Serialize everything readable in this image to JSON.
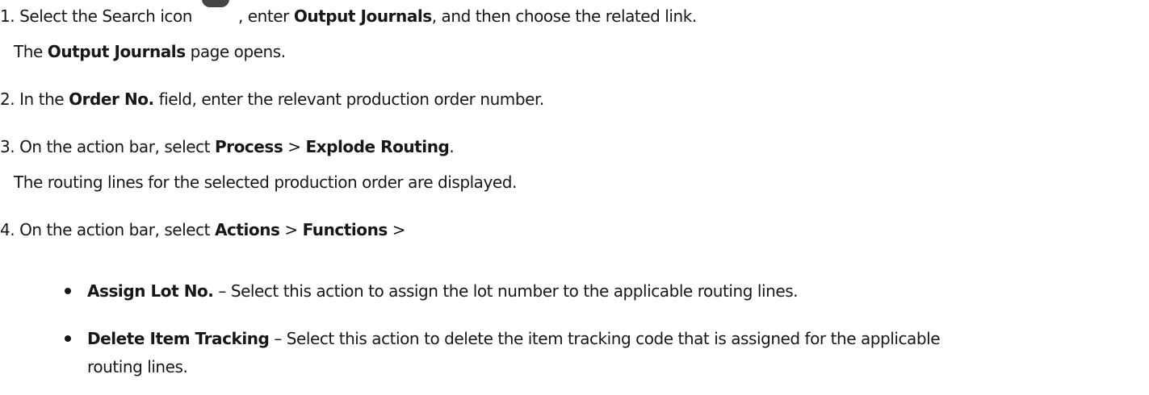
{
  "steps": [
    {
      "number": "1.",
      "pre": "Select the Search icon",
      "mid": ", enter ",
      "bold": "Output Journals",
      "post": ", and then choose the related link.",
      "result_bold": "Output Journals",
      "result_post": " page opens.",
      "result_pre": "The "
    },
    {
      "number": "2.",
      "pre": "In the ",
      "bold": "Order No.",
      "post": " field, enter the relevant production order number."
    },
    {
      "number": "3.",
      "pre": "On the action bar, select ",
      "bold1": "Process",
      "sep": " > ",
      "bold2": "Explode Routing",
      "post": ".",
      "result": "The routing lines for the selected production order are displayed."
    },
    {
      "number": "4.",
      "pre": "On the action bar, select ",
      "bold1": "Actions",
      "sep1": " > ",
      "bold2": "Functions",
      "sep2": " >",
      "bullets": [
        {
          "bold": "Assign Lot No.",
          "text": " – Select this action to assign the lot number to the applicable routing lines."
        },
        {
          "bold": "Delete Item Tracking",
          "text": " – Select this action to delete the item tracking code that is assigned for the applicable",
          "text2": "routing lines."
        }
      ]
    }
  ]
}
